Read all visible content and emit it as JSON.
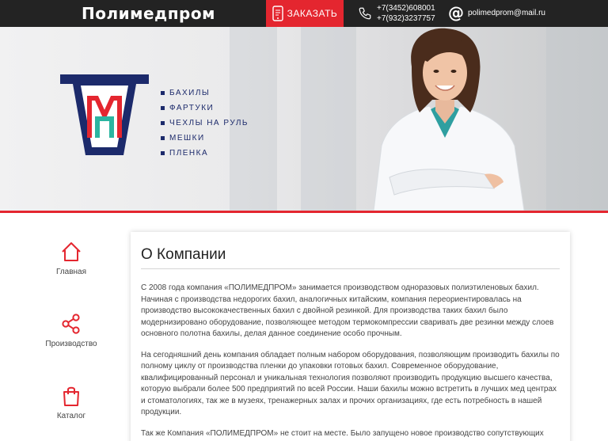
{
  "header": {
    "brand": "Полимедпром",
    "order_label": "ЗАКАЗАТЬ",
    "phone1": "+7(3452)608001",
    "phone2": "+7(932)3237757",
    "email": "polimedprom@mail.ru"
  },
  "hero": {
    "menu": [
      "БАХИЛЫ",
      "ФАРТУКИ",
      "ЧЕХЛЫ НА РУЛЬ",
      "МЕШКИ",
      "ПЛЕНКА"
    ]
  },
  "sidebar": {
    "items": [
      {
        "label": "Главная",
        "icon": "home-icon"
      },
      {
        "label": "Производство",
        "icon": "share-icon"
      },
      {
        "label": "Каталог",
        "icon": "shopping-bag-icon"
      }
    ]
  },
  "content": {
    "title": "О Компании",
    "paragraphs": [
      "С 2008 года компания «ПОЛИМЕДПРОМ» занимается производством одноразовых полиэтиленовых бахил. Начиная с производства недорогих бахил, аналогичных китайским, компания переориентировалась на производство высококачественных бахил с двойной резинкой. Для производства таких бахил было модернизировано оборудование, позволяющее методом термокомпрессии сваривать две резинки между слоев основного полотна бахилы, делая данное соединение особо прочным.",
      "На сегодняшний день компания обладает полным набором оборудования, позволяющим производить бахилы по полному циклу от производства пленки до упаковки готовых бахил. Современное оборудование, квалифицированный персонал и уникальная технология позволяют производить продукцию высшего качества, которую выбрали более 500 предприятий по всей России. Наши бахилы можно встретить в лучших мед центрах и стоматологиях, так же в музеях, тренажерных залах и прочих организациях, где есть потребность в нашей продукции.",
      "Так же Компания «ПОЛИМЕДПРОМ» не стоит на месте. Было запущено новое производство сопутствующих товаров изготовленных из полиэтилена низкого давления:"
    ]
  },
  "colors": {
    "accent": "#e4262f",
    "brand_blue": "#1c2a6b",
    "topbar": "#232323"
  }
}
